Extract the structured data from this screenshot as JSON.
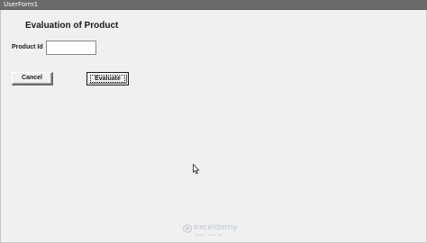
{
  "window": {
    "title": "UserForm1"
  },
  "form": {
    "heading": "Evaluation of Product",
    "product_id_label": "Product Id",
    "product_id_value": "",
    "cancel_label": "Cancel",
    "evaluate_label": "Evaluate"
  },
  "watermark": {
    "name": "exceldemy",
    "tagline": "EXCEL · DATA · BI",
    "icon": "exceldemy-logo-icon"
  },
  "icons": {
    "cursor": "mouse-pointer-icon"
  },
  "colors": {
    "titlebar": "#6b6b6b",
    "form_background": "#f0f0f0",
    "input_background": "#ffffff"
  }
}
